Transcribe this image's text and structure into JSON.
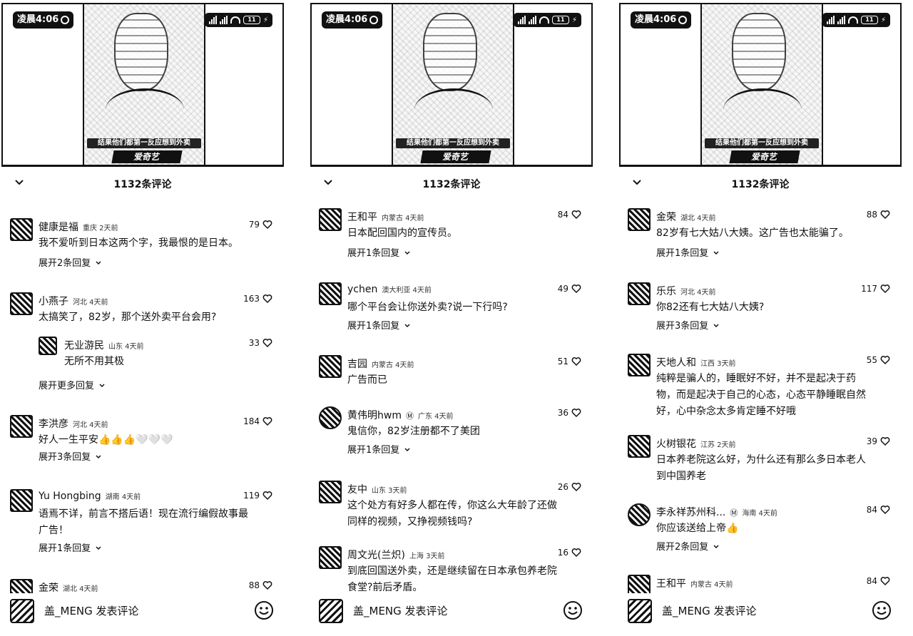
{
  "status": {
    "time": "凌晨4:06",
    "battery": "11"
  },
  "video": {
    "caption": "结果他们都第一反应想到外卖",
    "logo": "爱奇艺"
  },
  "panels": [
    {
      "count_label": "1132条评论",
      "placeholder": "盖_MENG 发表评论",
      "comments": [
        {
          "user": "健康是福",
          "info": "重庆 2天前",
          "text": "我不爱听到日本这两个字，我最恨的是日本。",
          "likes": "79",
          "expand": "展开2条回复"
        },
        {
          "user": "小燕子",
          "info": "河北 4天前",
          "text": "太搞笑了，82岁，那个送外卖平台会用?",
          "likes": "163",
          "expand": "展开更多回复",
          "reply": {
            "user": "无业游民",
            "info": "山东 4天前",
            "text": "无所不用其极",
            "likes": "33"
          }
        },
        {
          "user": "李洪彦",
          "info": "河北 4天前",
          "text": "好人一生平安👍👍👍🤍🤍🤍",
          "likes": "184",
          "expand": "展开3条回复"
        },
        {
          "user": "Yu Hongbing",
          "info": "湖南 4天前",
          "text": "语焉不详，前言不搭后语！现在流行编假故事最广告！",
          "likes": "119",
          "expand": "展开1条回复"
        },
        {
          "user": "金荣",
          "info": "湖北 4天前",
          "text": "",
          "likes": "88"
        }
      ]
    },
    {
      "count_label": "1132条评论",
      "placeholder": "盖_MENG 发表评论",
      "comments": [
        {
          "user": "王和平",
          "info": "内蒙古 4天前",
          "text": "日本配回国内的宣传员。",
          "likes": "84",
          "expand": "展开1条回复"
        },
        {
          "user": "ychen",
          "info": "澳大利亚 4天前",
          "text": "哪个平台会让你送外卖?说一下行吗?",
          "likes": "49",
          "expand": "展开1条回复"
        },
        {
          "user": "吉园",
          "info": "内蒙古 4天前",
          "text": "广告而已",
          "likes": "51"
        },
        {
          "user": "黄伟明hwm",
          "info": "广东 4天前",
          "text": "鬼信你，82岁注册都不了美团",
          "likes": "36",
          "expand": "展开1条回复"
        },
        {
          "user": "友中",
          "info": "山东 3天前",
          "text": "这个处方有好多人都在传，你这么大年龄了还做同样的视频，又挣视频钱吗?",
          "likes": "26"
        },
        {
          "user": "周文光(兰炽)",
          "info": "上海 3天前",
          "text": "到底回国送外卖，还是继续留在日本承包养老院食堂?前后矛盾。",
          "likes": "16"
        }
      ]
    },
    {
      "count_label": "1132条评论",
      "placeholder": "盖_MENG 发表评论",
      "comments": [
        {
          "user": "金荣",
          "info": "湖北 4天前",
          "text": "82岁有七大姑八大姨。这广告也太能骗了。",
          "likes": "88",
          "expand": "展开1条回复"
        },
        {
          "user": "乐乐",
          "info": "河北 4天前",
          "text": "你82还有七大姑八大姨?",
          "likes": "117",
          "expand": "展开3条回复"
        },
        {
          "user": "天地人和",
          "info": "江西 3天前",
          "text": "纯粹是骗人的，睡眠好不好，并不是起决于药物，而是起决于自己的心态，心态平静睡眠自然好，心中杂念太多肯定睡不好哦",
          "likes": "55"
        },
        {
          "user": "火树银花",
          "info": "江苏 2天前",
          "text": "日本养老院这么好，为什么还有那么多日本老人到中国养老",
          "likes": "39"
        },
        {
          "user": "李永祥苏州科...",
          "info": "海南 4天前",
          "text": "你应该送给上帝👍",
          "likes": "84",
          "expand": "展开2条回复"
        },
        {
          "user": "王和平",
          "info": "内蒙古 4天前",
          "text": "",
          "likes": "84"
        }
      ]
    }
  ]
}
